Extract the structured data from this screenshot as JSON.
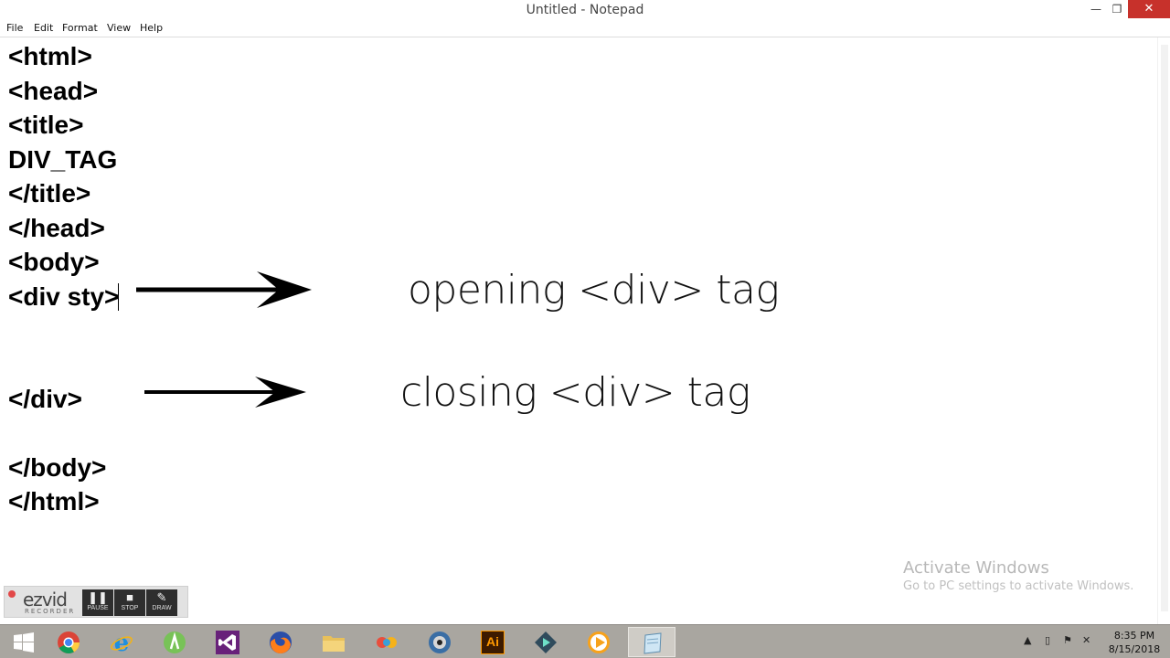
{
  "window": {
    "title": "Untitled - Notepad",
    "min_glyph": "—",
    "max_glyph": "❐",
    "close_glyph": "✕"
  },
  "menu": [
    "File",
    "Edit",
    "Format",
    "View",
    "Help"
  ],
  "editor": {
    "lines": [
      "<html>",
      "<head>",
      "<title>",
      "DIV_TAG",
      "</title>",
      "</head>",
      "<body>",
      "<div sty>",
      "</div>",
      "</body>",
      "</html>"
    ]
  },
  "annotations": {
    "opening": "opening <div> tag",
    "closing": "closing <div> tag"
  },
  "watermark": {
    "line1": "Activate Windows",
    "line2": "Go to PC settings to activate Windows."
  },
  "ezvid": {
    "logo": "ezvid",
    "subtitle": "RECORDER",
    "buttons": [
      "PAUSE",
      "STOP",
      "DRAW"
    ]
  },
  "taskbar": {
    "apps": [
      "windows-start",
      "chrome",
      "internet-explorer",
      "android-studio",
      "visual-studio",
      "firefox",
      "file-explorer",
      "app-colorful",
      "app-globe",
      "illustrator",
      "filmora",
      "media-player",
      "notepad"
    ],
    "illustrator_text": "Ai",
    "clock_time": "8:35 PM",
    "clock_date": "8/15/2018"
  },
  "colors": {
    "close_button": "#c7312b",
    "taskbar": "#a9a6a0",
    "visual_studio": "#68217a",
    "illustrator": "#ff9a00"
  }
}
